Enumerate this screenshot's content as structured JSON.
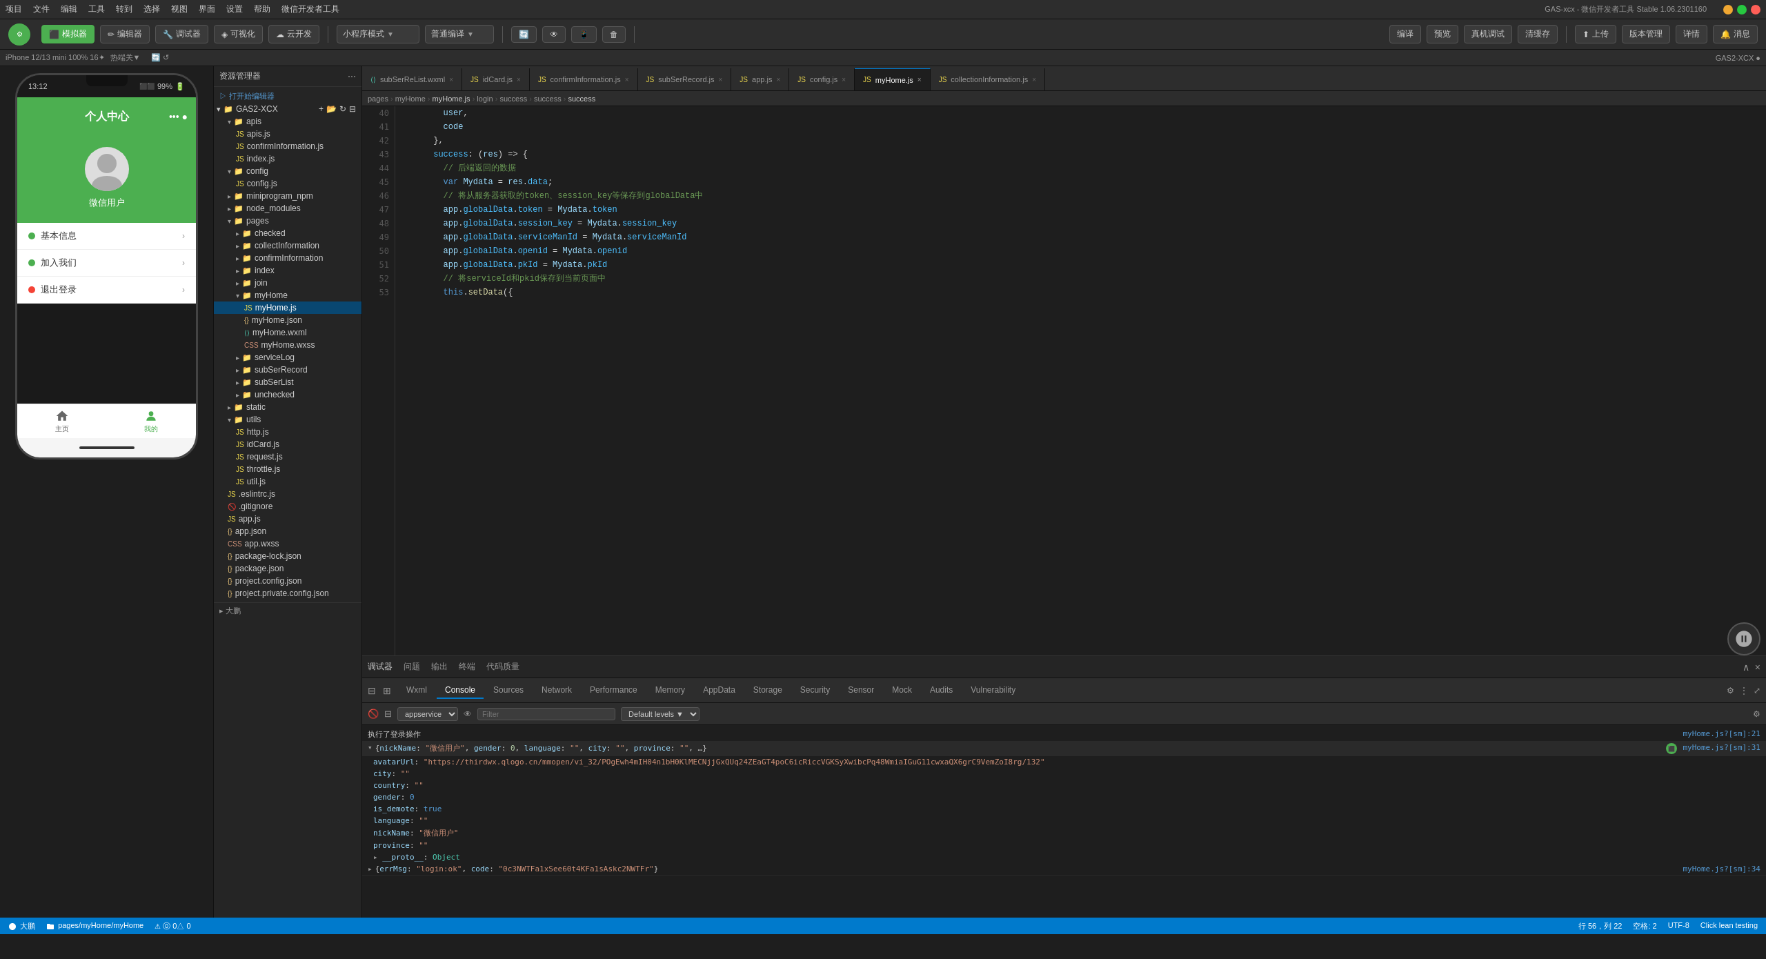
{
  "window": {
    "title": "GAS-xcx - 微信开发者工具 Stable 1.06.2301160",
    "menu_items": [
      "项目",
      "文件",
      "编辑",
      "工具",
      "转到",
      "选择",
      "视图",
      "界面",
      "设置",
      "帮助",
      "微信开发者工具"
    ]
  },
  "toolbar": {
    "simulator_btn": "模拟器",
    "editor_btn": "编辑器",
    "debug_btn": "调试器",
    "visual_btn": "可视化",
    "cloud_btn": "云开发",
    "compile_btn": "编译",
    "preview_btn": "预览",
    "real_device_btn": "真机调试",
    "cache_btn": "清缓存",
    "mode_label": "小程序模式",
    "compile_label": "普通编译",
    "upload_btn": "上传",
    "version_btn": "版本管理",
    "details_btn": "详情",
    "messages_btn": "消息"
  },
  "status_bar": {
    "device": "iPhone 12/13 mini 100% 16✦",
    "hotspot": "热端关▼",
    "branch": "GAS2-XCX",
    "time": "13:12",
    "battery": "99%"
  },
  "file_tree": {
    "title": "资源管理器",
    "root": "GAS2-XCX",
    "items": [
      {
        "name": "打开始编辑器",
        "level": 0,
        "type": "action"
      },
      {
        "name": "apis",
        "level": 1,
        "type": "folder"
      },
      {
        "name": "apis.js",
        "level": 2,
        "type": "js"
      },
      {
        "name": "confirmInformation.js",
        "level": 2,
        "type": "js"
      },
      {
        "name": "index.js",
        "level": 2,
        "type": "js"
      },
      {
        "name": "config",
        "level": 1,
        "type": "folder"
      },
      {
        "name": "config.js",
        "level": 2,
        "type": "js"
      },
      {
        "name": "miniprogram_npm",
        "level": 1,
        "type": "folder"
      },
      {
        "name": "node_modules",
        "level": 1,
        "type": "folder"
      },
      {
        "name": "pages",
        "level": 1,
        "type": "folder"
      },
      {
        "name": "checked",
        "level": 2,
        "type": "folder"
      },
      {
        "name": "collectInformation",
        "level": 2,
        "type": "folder"
      },
      {
        "name": "confirmInformation",
        "level": 2,
        "type": "folder"
      },
      {
        "name": "index",
        "level": 2,
        "type": "folder"
      },
      {
        "name": "join",
        "level": 2,
        "type": "folder"
      },
      {
        "name": "myHome",
        "level": 2,
        "type": "folder",
        "expanded": true
      },
      {
        "name": "myHome.js",
        "level": 3,
        "type": "js",
        "selected": true
      },
      {
        "name": "myHome.json",
        "level": 3,
        "type": "json"
      },
      {
        "name": "myHome.wxml",
        "level": 3,
        "type": "wxml"
      },
      {
        "name": "myHome.wxss",
        "level": 3,
        "type": "wxss"
      },
      {
        "name": "serviceLog",
        "level": 2,
        "type": "folder"
      },
      {
        "name": "subSerRecord",
        "level": 2,
        "type": "folder"
      },
      {
        "name": "subSerList",
        "level": 2,
        "type": "folder"
      },
      {
        "name": "unchecked",
        "level": 2,
        "type": "folder"
      },
      {
        "name": "static",
        "level": 1,
        "type": "folder"
      },
      {
        "name": "utils",
        "level": 1,
        "type": "folder",
        "expanded": true
      },
      {
        "name": "http.js",
        "level": 2,
        "type": "js"
      },
      {
        "name": "idCard.js",
        "level": 2,
        "type": "js"
      },
      {
        "name": "request.js",
        "level": 2,
        "type": "js"
      },
      {
        "name": "throttle.js",
        "level": 2,
        "type": "js"
      },
      {
        "name": "util.js",
        "level": 2,
        "type": "js"
      },
      {
        "name": ".eslintrc.js",
        "level": 1,
        "type": "js"
      },
      {
        "name": ".gitignore",
        "level": 1,
        "type": "gitignore"
      },
      {
        "name": "app.js",
        "level": 1,
        "type": "js"
      },
      {
        "name": "app.json",
        "level": 1,
        "type": "json"
      },
      {
        "name": "app.wxss",
        "level": 1,
        "type": "wxss"
      },
      {
        "name": "package-lock.json",
        "level": 1,
        "type": "json"
      },
      {
        "name": "package.json",
        "level": 1,
        "type": "json"
      },
      {
        "name": "project.config.json",
        "level": 1,
        "type": "json"
      },
      {
        "name": "project.private.config.json",
        "level": 1,
        "type": "json"
      }
    ]
  },
  "editor": {
    "tabs": [
      {
        "name": "subSerReList.wxml",
        "active": false
      },
      {
        "name": "idCard.js",
        "active": false
      },
      {
        "name": "confirmInformation.js",
        "active": false
      },
      {
        "name": "subSerRecord.js",
        "active": false
      },
      {
        "name": "app.js",
        "active": false
      },
      {
        "name": "config.js",
        "active": false
      },
      {
        "name": "myHome.js",
        "active": true
      },
      {
        "name": "collectionInformation.js",
        "active": false
      }
    ],
    "breadcrumb": "pages > myHome > myHome.js > login > success > success > success",
    "lines": [
      {
        "num": 40,
        "content": "    user,"
      },
      {
        "num": 41,
        "content": "    code"
      },
      {
        "num": 42,
        "content": "  },"
      },
      {
        "num": 43,
        "content": "  success: (res) => {",
        "expanded": true
      },
      {
        "num": 44,
        "content": "    // 后端返回的数据",
        "type": "comment"
      },
      {
        "num": 45,
        "content": "    var Mydata = res.data;"
      },
      {
        "num": 46,
        "content": "    // 将从服务器获取的token、session_key等保存到globalData中",
        "type": "comment"
      },
      {
        "num": 47,
        "content": "    app.globalData.token = Mydata.token"
      },
      {
        "num": 48,
        "content": "    app.globalData.session_key = Mydata.session_key"
      },
      {
        "num": 49,
        "content": "    app.globalData.serviceManId = Mydata.serviceManId"
      },
      {
        "num": 50,
        "content": "    app.globalData.openid = Mydata.openid"
      },
      {
        "num": 51,
        "content": "    app.globalData.pkId = Mydata.pkId"
      },
      {
        "num": 52,
        "content": "    // 将serviceId和pkid保存到当前页面中",
        "type": "comment"
      },
      {
        "num": 53,
        "content": "    this.setData({"
      }
    ]
  },
  "devtools": {
    "tabs": [
      "调试器",
      "问题",
      "输出",
      "终端",
      "代码质量"
    ],
    "console_tabs": [
      "Wxml",
      "Console",
      "Sources",
      "Network",
      "Performance",
      "Memory",
      "AppData",
      "Storage",
      "Security",
      "Sensor",
      "Mock",
      "Audits",
      "Vulnerability"
    ],
    "active_tab": "Console",
    "toolbar": {
      "context": "appservice",
      "filter_placeholder": "Filter",
      "level": "Default levels"
    },
    "console_entries": [
      {
        "type": "log",
        "text": "执行了登录操作",
        "source": "myHome.js?[sm]:21"
      },
      {
        "type": "obj",
        "text": "{nickName: \"微信用户\", gender: 0, language: \"\", city: \"\", province: \"\", …}",
        "source": "myHome.js?[sm]:31",
        "expanded": true,
        "props": [
          {
            "key": "avatarUrl",
            "val": "\"https://thirdwx.qlogo.cn/mmopen/vi_32/POgEwh4mIH04n1bH0KlMECNjjGxQUq24ZEaGT4poC6icRiccVGKSyXwibcPq48WmiaIGuG11cwxaQX6grC9VemZoI8rg/132\""
          },
          {
            "key": "city",
            "val": "\"\""
          },
          {
            "key": "country",
            "val": "\"\""
          },
          {
            "key": "gender",
            "val": "0"
          },
          {
            "key": "is_demote",
            "val": "true"
          },
          {
            "key": "language",
            "val": "\"\""
          },
          {
            "key": "nickName",
            "val": "\"微信用户\""
          },
          {
            "key": "province",
            "val": "\"\""
          },
          {
            "key": "__proto__",
            "val": "Object"
          }
        ]
      },
      {
        "type": "log",
        "text": "{errMsg: \"login:ok\", code: \"0c3NWTFa1xSee60t4KFa1sAskc2NWTFr\"}",
        "source": "myHome.js?[sm]:34"
      }
    ]
  },
  "bottom_status": {
    "branch": "大鹏",
    "path": "pages/myHome/myHome",
    "errors": "⓪ 0△ 0",
    "cursor": "行 56，列 22",
    "spaces": "空格: 2",
    "encoding": "UTF-8",
    "action": "Click lean testing"
  },
  "phone": {
    "time": "13:12",
    "battery": "99%",
    "title": "个人中心",
    "username": "微信用户",
    "menu_items": [
      {
        "icon": "green",
        "label": "基本信息"
      },
      {
        "icon": "green",
        "label": "加入我们"
      },
      {
        "icon": "red",
        "label": "退出登录"
      }
    ],
    "nav": [
      "主页",
      "我的"
    ]
  }
}
